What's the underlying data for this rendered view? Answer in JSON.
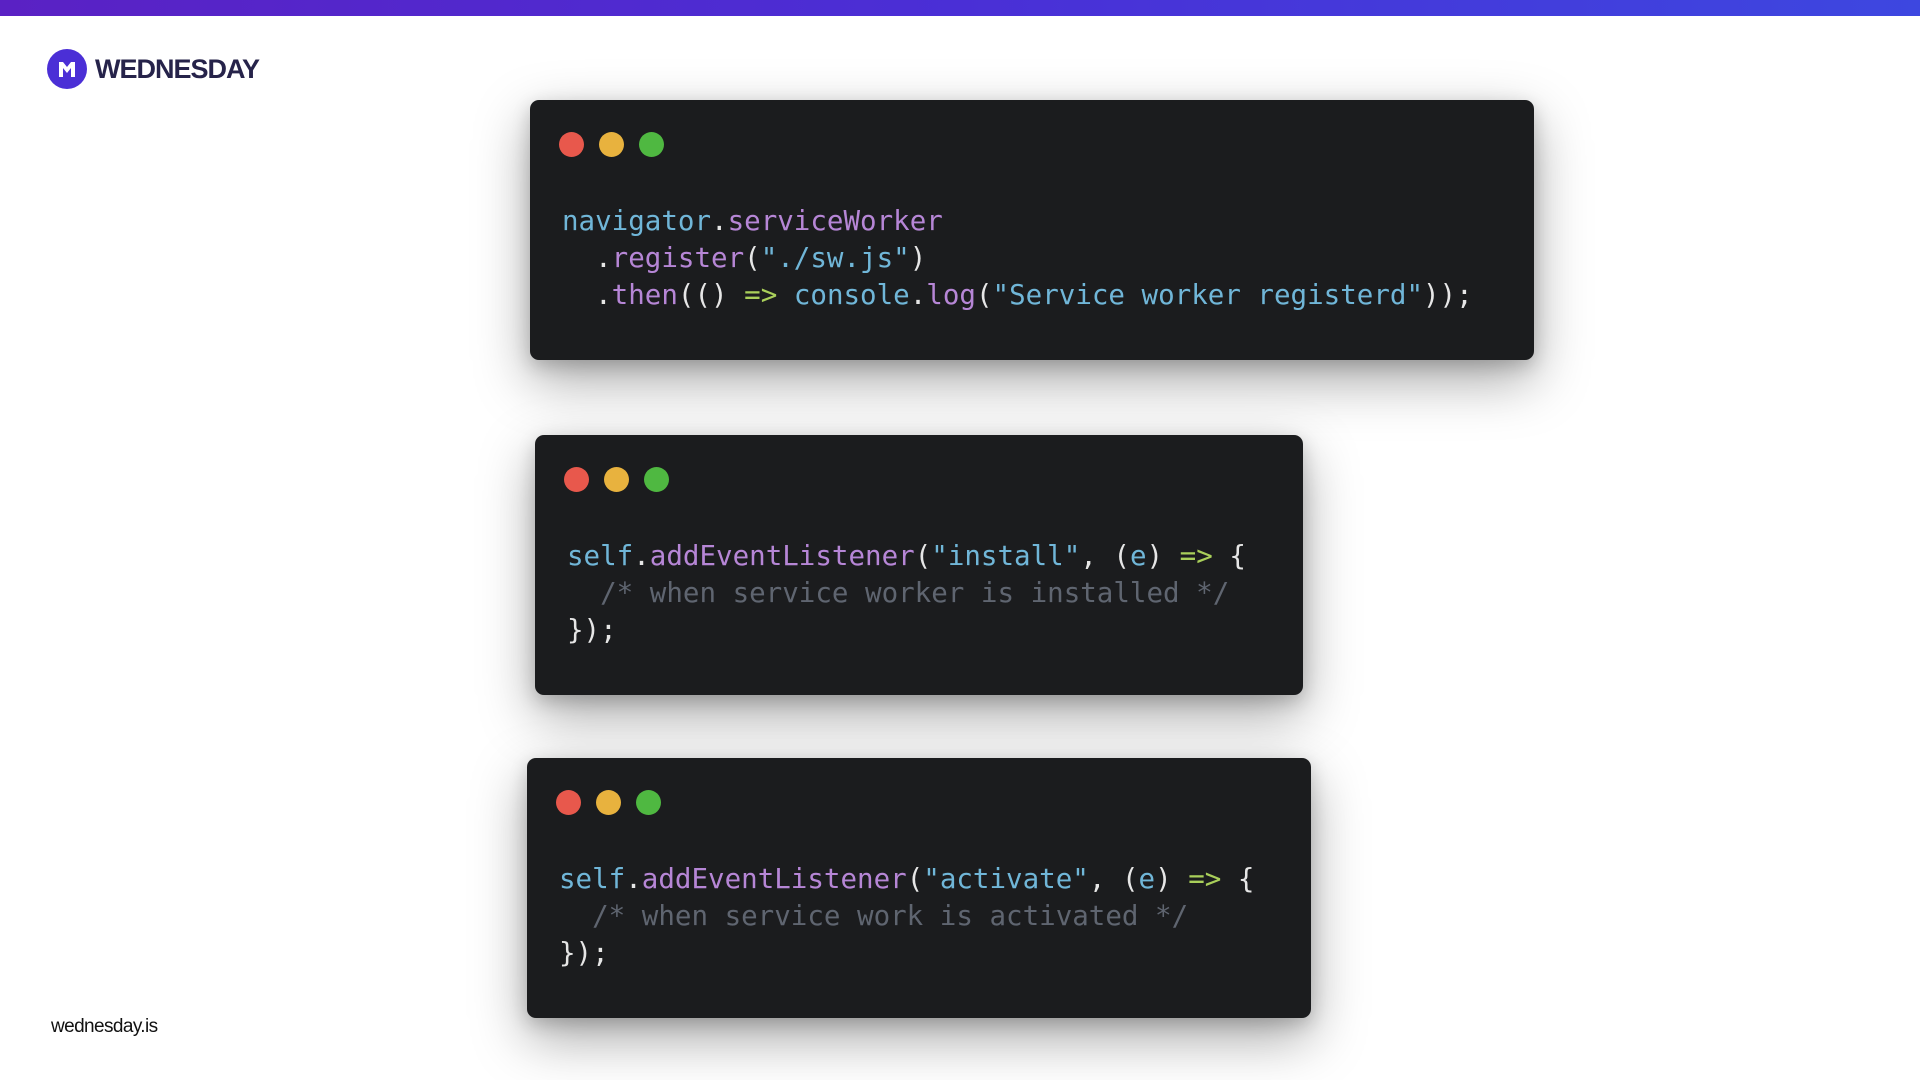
{
  "brand": {
    "name": "WEDNESDAY",
    "website": "wednesday.is",
    "accent_color": "#4b2fd6",
    "icon": "wednesday-logo-icon"
  },
  "code_windows": [
    {
      "lines": [
        [
          {
            "t": "navigator",
            "c": "blue"
          },
          {
            "t": ".",
            "c": "white"
          },
          {
            "t": "serviceWorker",
            "c": "purple"
          }
        ],
        [
          {
            "t": "  .",
            "c": "white"
          },
          {
            "t": "register",
            "c": "purple"
          },
          {
            "t": "(",
            "c": "white"
          },
          {
            "t": "\"./sw.js\"",
            "c": "blue"
          },
          {
            "t": ")",
            "c": "white"
          }
        ],
        [
          {
            "t": "  .",
            "c": "white"
          },
          {
            "t": "then",
            "c": "purple"
          },
          {
            "t": "(() ",
            "c": "white"
          },
          {
            "t": "=>",
            "c": "green"
          },
          {
            "t": " ",
            "c": "white"
          },
          {
            "t": "console",
            "c": "blue"
          },
          {
            "t": ".",
            "c": "white"
          },
          {
            "t": "log",
            "c": "purple"
          },
          {
            "t": "(",
            "c": "white"
          },
          {
            "t": "\"Service worker registerd\"",
            "c": "blue"
          },
          {
            "t": "));",
            "c": "white"
          }
        ]
      ]
    },
    {
      "lines": [
        [
          {
            "t": "self",
            "c": "blue"
          },
          {
            "t": ".",
            "c": "white"
          },
          {
            "t": "addEventListener",
            "c": "purple"
          },
          {
            "t": "(",
            "c": "white"
          },
          {
            "t": "\"install\"",
            "c": "blue"
          },
          {
            "t": ", (",
            "c": "white"
          },
          {
            "t": "e",
            "c": "blue"
          },
          {
            "t": ") ",
            "c": "white"
          },
          {
            "t": "=>",
            "c": "green"
          },
          {
            "t": " {",
            "c": "white"
          }
        ],
        [
          {
            "t": "  /* when service worker is installed */",
            "c": "comment"
          }
        ],
        [
          {
            "t": "});",
            "c": "white"
          }
        ]
      ]
    },
    {
      "lines": [
        [
          {
            "t": "self",
            "c": "blue"
          },
          {
            "t": ".",
            "c": "white"
          },
          {
            "t": "addEventListener",
            "c": "purple"
          },
          {
            "t": "(",
            "c": "white"
          },
          {
            "t": "\"activate\"",
            "c": "blue"
          },
          {
            "t": ", (",
            "c": "white"
          },
          {
            "t": "e",
            "c": "blue"
          },
          {
            "t": ") ",
            "c": "white"
          },
          {
            "t": "=>",
            "c": "green"
          },
          {
            "t": " {",
            "c": "white"
          }
        ],
        [
          {
            "t": "  /* when service work is activated */",
            "c": "comment"
          }
        ],
        [
          {
            "t": "});",
            "c": "white"
          }
        ]
      ]
    }
  ],
  "window_controls": {
    "close_color": "#e8584c",
    "minimize_color": "#e8b23e",
    "maximize_color": "#4fb841"
  },
  "syntax_colors": {
    "blue": "#70b6d8",
    "purple": "#b686d6",
    "white": "#e6e6e6",
    "green": "#a9cf5a",
    "comment": "#5f6570"
  }
}
